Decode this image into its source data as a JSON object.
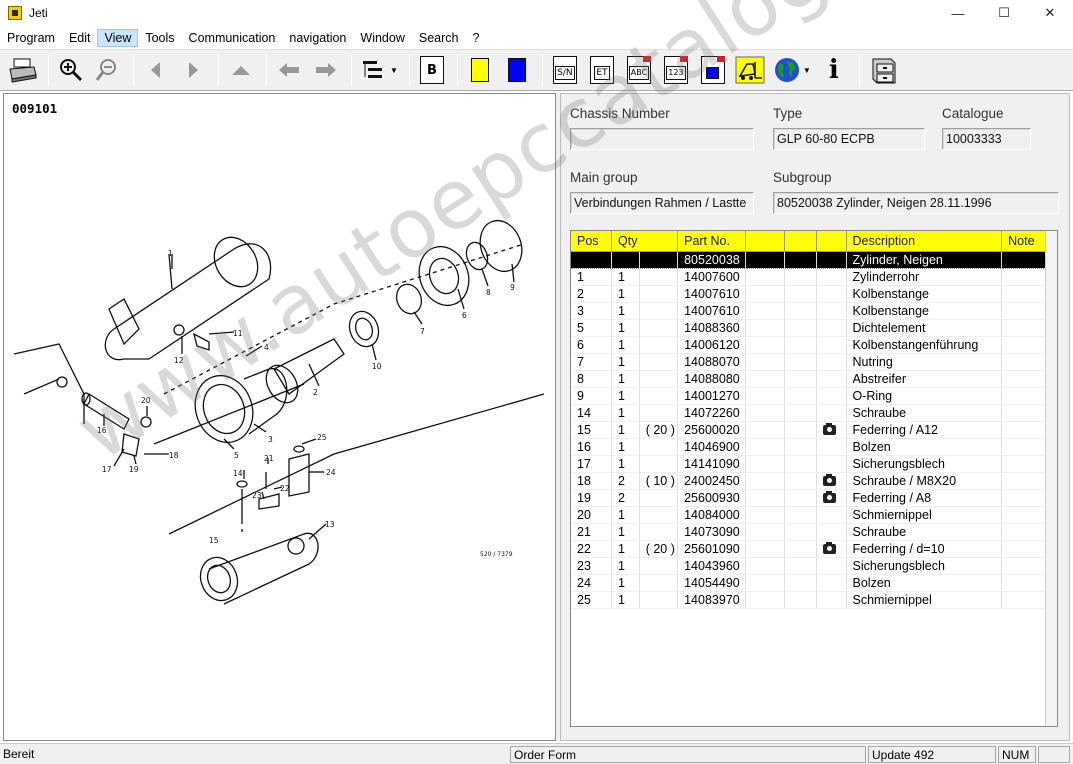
{
  "window": {
    "title": "Jeti",
    "minimize": "—",
    "maximize": "☐",
    "close": "✕"
  },
  "menu": [
    "Program",
    "Edit",
    "View",
    "Tools",
    "Communication",
    "navigation",
    "Window",
    "Search",
    "?"
  ],
  "menu_active_index": 2,
  "toolbar": {
    "icons": [
      "print-icon",
      "zoom-in-icon",
      "zoom-out-icon",
      "arrow-left-icon",
      "arrow-right-icon",
      "arrow-up-icon",
      "back-icon",
      "forward-icon",
      "tree-icon",
      "bookmark-icon",
      "yellow-marker-icon",
      "blue-marker-icon",
      "serial-number-icon",
      "et-icon",
      "abc-icon",
      "123-icon",
      "blue-doc-icon",
      "forklift-icon",
      "globe-icon",
      "info-icon",
      "cabinet-icon"
    ],
    "bookmark_label": "B",
    "sn_label": "S/N",
    "et_label": "ET",
    "abc_label": "ABC",
    "num_label": "123",
    "info_label": "i",
    "colors": {
      "yellow": "#ffff00",
      "blue": "#0000ff"
    }
  },
  "drawing": {
    "id": "009101",
    "ref": "520 / 7379",
    "callouts": [
      "1",
      "2",
      "3",
      "4",
      "5",
      "6",
      "7",
      "8",
      "9",
      "10",
      "11",
      "12",
      "13",
      "14",
      "15",
      "16",
      "17",
      "18",
      "19",
      "20",
      "21",
      "22",
      "23",
      "24",
      "25"
    ]
  },
  "header_fields": {
    "chassis_label": "Chassis Number",
    "chassis_value": "",
    "type_label": "Type",
    "type_value": "GLP 60-80 ECPB",
    "catalogue_label": "Catalogue",
    "catalogue_value": "10003333",
    "main_group_label": "Main group",
    "main_group_value": "Verbindungen Rahmen / Lastte",
    "subgroup_label": "Subgroup",
    "subgroup_value": "80520038  Zylinder, Neigen 28.11.1996"
  },
  "parts_table": {
    "columns": [
      "Pos",
      "Qty",
      "",
      "Part No.",
      "",
      "",
      "",
      "Description",
      "Note"
    ],
    "rows": [
      {
        "pos": "",
        "qty": "",
        "qty_extra": "",
        "part": "80520038",
        "cam": false,
        "desc": "Zylinder, Neigen",
        "selected": true
      },
      {
        "pos": "1",
        "qty": "1",
        "qty_extra": "",
        "part": "14007600",
        "cam": false,
        "desc": "Zylinderrohr"
      },
      {
        "pos": "2",
        "qty": "1",
        "qty_extra": "",
        "part": "14007610",
        "cam": false,
        "desc": "Kolbenstange"
      },
      {
        "pos": "3",
        "qty": "1",
        "qty_extra": "",
        "part": "14007610",
        "cam": false,
        "desc": "Kolbenstange"
      },
      {
        "pos": "5",
        "qty": "1",
        "qty_extra": "",
        "part": "14088360",
        "cam": false,
        "desc": "Dichtelement"
      },
      {
        "pos": "6",
        "qty": "1",
        "qty_extra": "",
        "part": "14006120",
        "cam": false,
        "desc": "Kolbenstangenführung"
      },
      {
        "pos": "7",
        "qty": "1",
        "qty_extra": "",
        "part": "14088070",
        "cam": false,
        "desc": "Nutring"
      },
      {
        "pos": "8",
        "qty": "1",
        "qty_extra": "",
        "part": "14088080",
        "cam": false,
        "desc": "Abstreifer"
      },
      {
        "pos": "9",
        "qty": "1",
        "qty_extra": "",
        "part": "14001270",
        "cam": false,
        "desc": "O-Ring"
      },
      {
        "pos": "14",
        "qty": "1",
        "qty_extra": "",
        "part": "14072260",
        "cam": false,
        "desc": "Schraube"
      },
      {
        "pos": "15",
        "qty": "1",
        "qty_extra": "( 20 )",
        "part": "25600020",
        "cam": true,
        "desc": "Federring / A12"
      },
      {
        "pos": "16",
        "qty": "1",
        "qty_extra": "",
        "part": "14046900",
        "cam": false,
        "desc": "Bolzen"
      },
      {
        "pos": "17",
        "qty": "1",
        "qty_extra": "",
        "part": "14141090",
        "cam": false,
        "desc": "Sicherungsblech"
      },
      {
        "pos": "18",
        "qty": "2",
        "qty_extra": "( 10 )",
        "part": "24002450",
        "cam": true,
        "desc": "Schraube / M8X20"
      },
      {
        "pos": "19",
        "qty": "2",
        "qty_extra": "",
        "part": "25600930",
        "cam": true,
        "desc": "Federring / A8"
      },
      {
        "pos": "20",
        "qty": "1",
        "qty_extra": "",
        "part": "14084000",
        "cam": false,
        "desc": "Schmiernippel"
      },
      {
        "pos": "21",
        "qty": "1",
        "qty_extra": "",
        "part": "14073090",
        "cam": false,
        "desc": "Schraube"
      },
      {
        "pos": "22",
        "qty": "1",
        "qty_extra": "( 20 )",
        "part": "25601090",
        "cam": true,
        "desc": "Federring / d=10"
      },
      {
        "pos": "23",
        "qty": "1",
        "qty_extra": "",
        "part": "14043960",
        "cam": false,
        "desc": "Sicherungsblech"
      },
      {
        "pos": "24",
        "qty": "1",
        "qty_extra": "",
        "part": "14054490",
        "cam": false,
        "desc": "Bolzen"
      },
      {
        "pos": "25",
        "qty": "1",
        "qty_extra": "",
        "part": "14083970",
        "cam": false,
        "desc": "Schmiernippel"
      }
    ]
  },
  "status": {
    "state": "Bereit",
    "order_form": "Order Form",
    "update": "Update 492",
    "num": "NUM"
  },
  "watermark": "www.autoepccatalog.com"
}
